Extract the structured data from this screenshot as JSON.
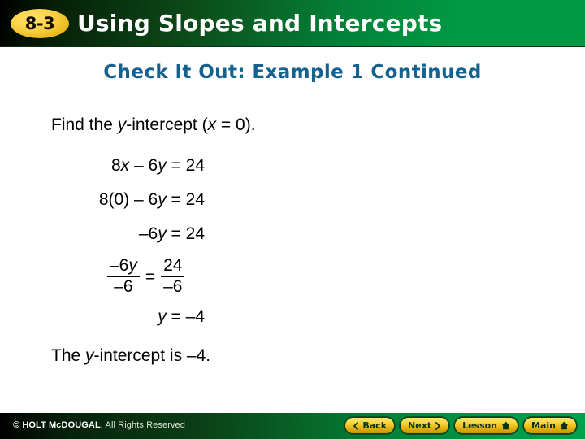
{
  "header": {
    "badge": "8-3",
    "title": "Using Slopes and Intercepts",
    "badge_color": "#f3cc3e",
    "gradient_from": "#000000",
    "gradient_to": "#009944"
  },
  "subtitle": {
    "text": "Check It Out: Example 1 Continued",
    "color": "#15618f"
  },
  "body": {
    "prompt": {
      "before": "Find the ",
      "var1": "y",
      "middle": "-intercept (",
      "var2": "x",
      "after": " = 0)."
    },
    "steps": [
      {
        "line": "8x – 6y = 24",
        "coef": "8",
        "var": "x",
        "op": " – 6",
        "var2": "y",
        "tail": " = 24"
      },
      {
        "line": "8(0) – 6y = 24",
        "coef": "8(0)",
        "op": " – 6",
        "var2": "y",
        "tail": " = 24"
      },
      {
        "line": "–6y = 24",
        "coef": "–6",
        "var2": "y",
        "tail": " = 24"
      }
    ],
    "step1": {
      "a": "8",
      "x": "x",
      "b": " – 6",
      "y": "y",
      "c": " = 24"
    },
    "step2": {
      "a": "8(0) – 6",
      "y": "y",
      "c": " = 24"
    },
    "step3": {
      "a": "–6",
      "y": "y",
      "c": " = 24"
    },
    "fraction": {
      "left_numerator_coef": "–6",
      "left_numerator_var": "y",
      "left_denominator": "–6",
      "equals": "=",
      "right_numerator": "24",
      "right_denominator": "–6"
    },
    "solution": {
      "var": "y",
      "value": " = –4"
    },
    "conclusion": {
      "before": "The ",
      "var": "y",
      "after": "-intercept is –4."
    }
  },
  "footer": {
    "copyright_mark": "© HOLT McDOUGAL",
    "copyright_rest": ", All Rights Reserved",
    "buttons": [
      {
        "label": "Back",
        "icon": "chevron-left-icon"
      },
      {
        "label": "Next",
        "icon": "chevron-right-icon"
      },
      {
        "label": "Lesson",
        "icon": "home-icon"
      },
      {
        "label": "Main",
        "icon": "home-icon"
      }
    ],
    "button_color": "#f0c52a"
  }
}
